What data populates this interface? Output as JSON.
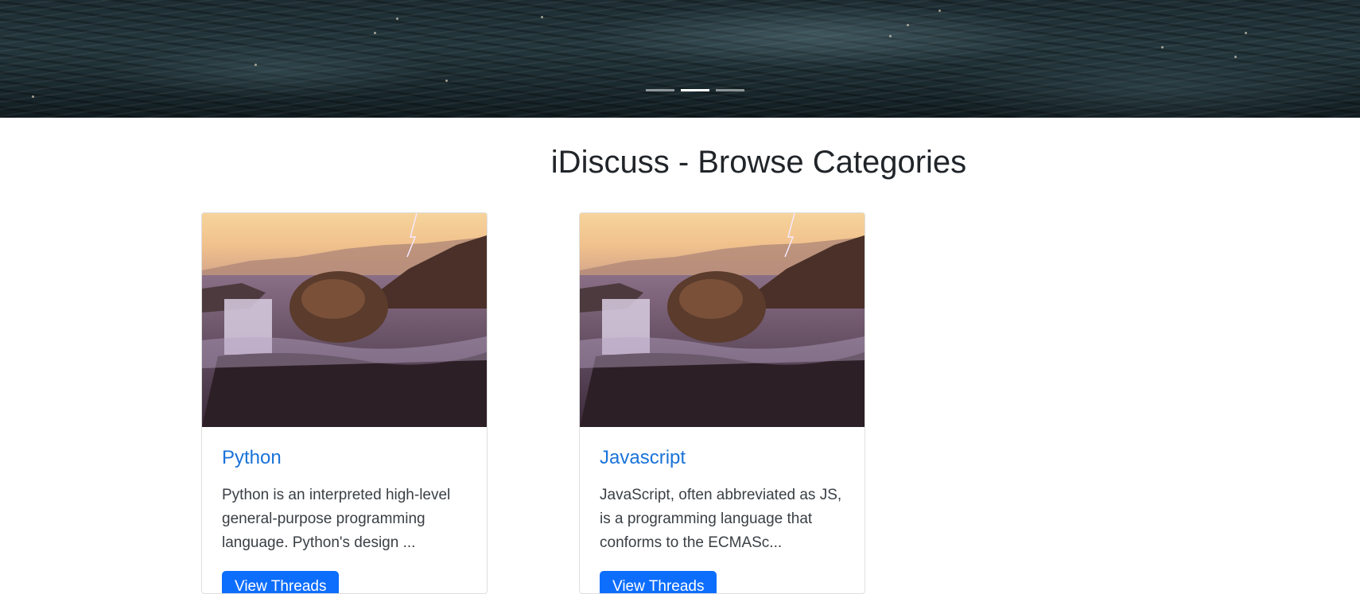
{
  "carousel": {
    "indicators": [
      {
        "label": "Slide 1",
        "active": false
      },
      {
        "label": "Slide 2",
        "active": true
      },
      {
        "label": "Slide 3",
        "active": false
      }
    ]
  },
  "page": {
    "title": "iDiscuss - Browse Categories"
  },
  "categories": [
    {
      "title": "Python",
      "description": "Python is an interpreted high-level general-purpose programming language. Python's design ...",
      "button_label": "View Threads"
    },
    {
      "title": "Javascript",
      "description": "JavaScript, often abbreviated as JS, is a programming language that conforms to the ECMASc...",
      "button_label": "View Threads"
    }
  ],
  "colors": {
    "primary": "#0d6efd",
    "link": "#1a73d9",
    "heading": "#212529"
  }
}
